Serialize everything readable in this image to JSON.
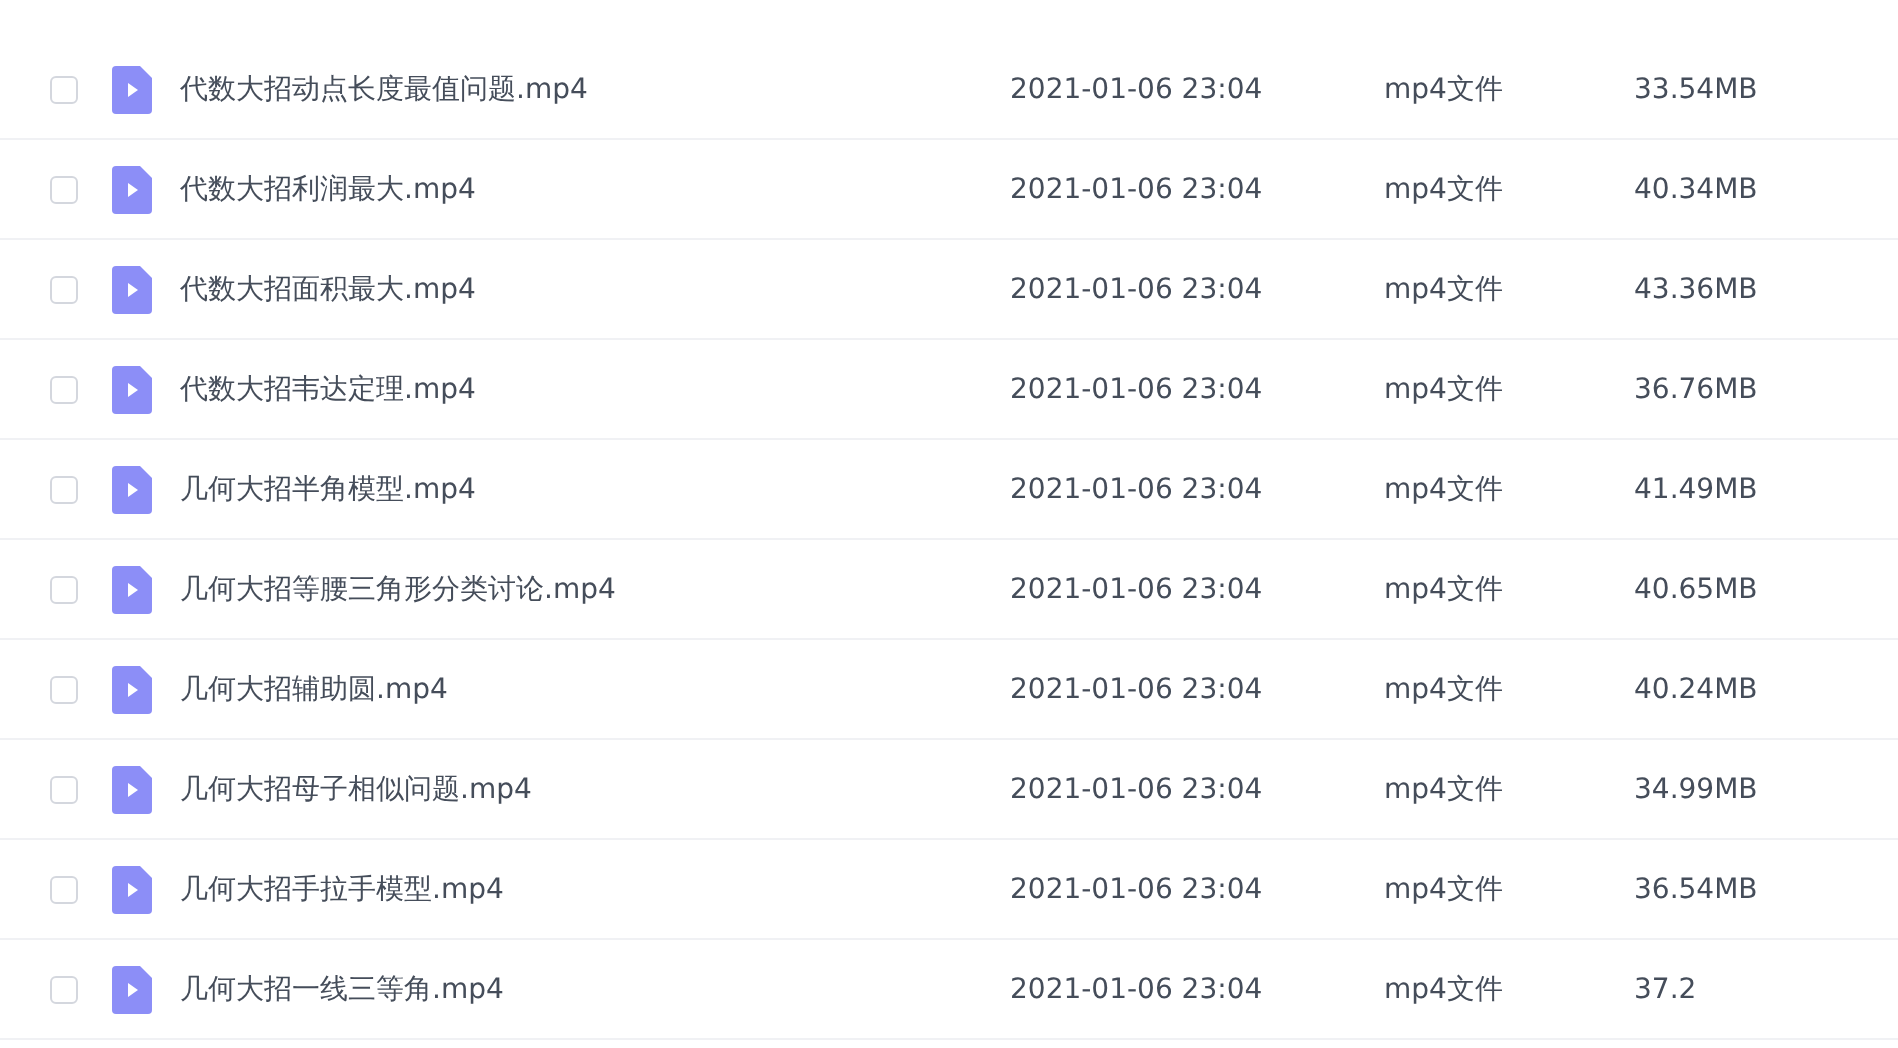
{
  "files": [
    {
      "name": "代数大招动点长度最值问题.mp4",
      "modified": "2021-01-06 23:04",
      "type": "mp4文件",
      "size": "33.54MB",
      "checked": false
    },
    {
      "name": "代数大招利润最大.mp4",
      "modified": "2021-01-06 23:04",
      "type": "mp4文件",
      "size": "40.34MB",
      "checked": false
    },
    {
      "name": "代数大招面积最大.mp4",
      "modified": "2021-01-06 23:04",
      "type": "mp4文件",
      "size": "43.36MB",
      "checked": false
    },
    {
      "name": "代数大招韦达定理.mp4",
      "modified": "2021-01-06 23:04",
      "type": "mp4文件",
      "size": "36.76MB",
      "checked": false
    },
    {
      "name": "几何大招半角模型.mp4",
      "modified": "2021-01-06 23:04",
      "type": "mp4文件",
      "size": "41.49MB",
      "checked": false
    },
    {
      "name": "几何大招等腰三角形分类讨论.mp4",
      "modified": "2021-01-06 23:04",
      "type": "mp4文件",
      "size": "40.65MB",
      "checked": false
    },
    {
      "name": "几何大招辅助圆.mp4",
      "modified": "2021-01-06 23:04",
      "type": "mp4文件",
      "size": "40.24MB",
      "checked": false
    },
    {
      "name": "几何大招母子相似问题.mp4",
      "modified": "2021-01-06 23:04",
      "type": "mp4文件",
      "size": "34.99MB",
      "checked": false
    },
    {
      "name": "几何大招手拉手模型.mp4",
      "modified": "2021-01-06 23:04",
      "type": "mp4文件",
      "size": "36.54MB",
      "checked": false
    },
    {
      "name": "几何大招一线三等角.mp4",
      "modified": "2021-01-06 23:04",
      "type": "mp4文件",
      "size": "37.2",
      "checked": false
    }
  ]
}
